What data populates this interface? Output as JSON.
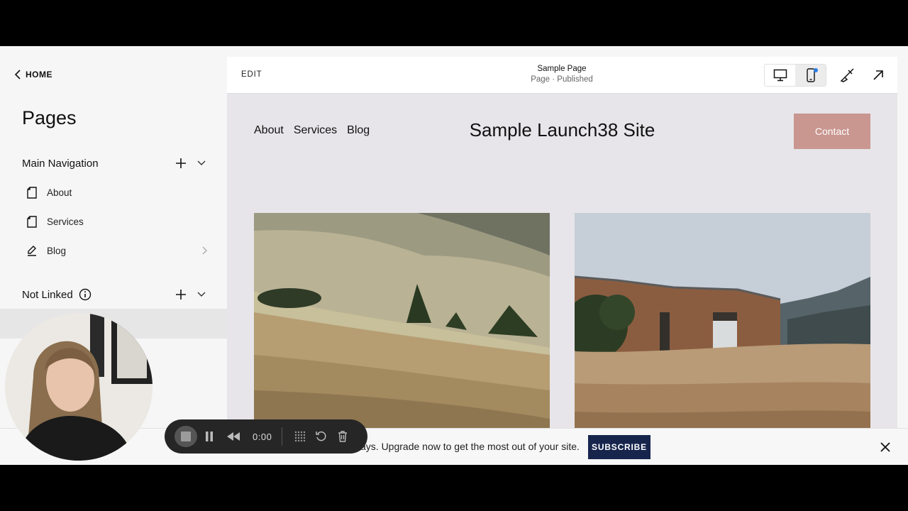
{
  "sidebar": {
    "back_label": "HOME",
    "title": "Pages",
    "main_nav": {
      "label": "Main Navigation",
      "items": [
        {
          "label": "About",
          "icon": "page-icon"
        },
        {
          "label": "Services",
          "icon": "page-icon"
        },
        {
          "label": "Blog",
          "icon": "blog-icon"
        }
      ]
    },
    "not_linked": {
      "label": "Not Linked"
    }
  },
  "topbar": {
    "edit_label": "EDIT",
    "page_title": "Sample Page",
    "page_status": "Page · Published"
  },
  "site": {
    "nav": [
      "About",
      "Services",
      "Blog"
    ],
    "title": "Sample Launch38 Site",
    "cta": "Contact",
    "accent": "#c99690"
  },
  "banner": {
    "text": "ays. Upgrade now to get the most out of your site.",
    "subscribe": "SUBSCRIBE",
    "button_color": "#17254d"
  },
  "recorder": {
    "time": "0:00"
  }
}
